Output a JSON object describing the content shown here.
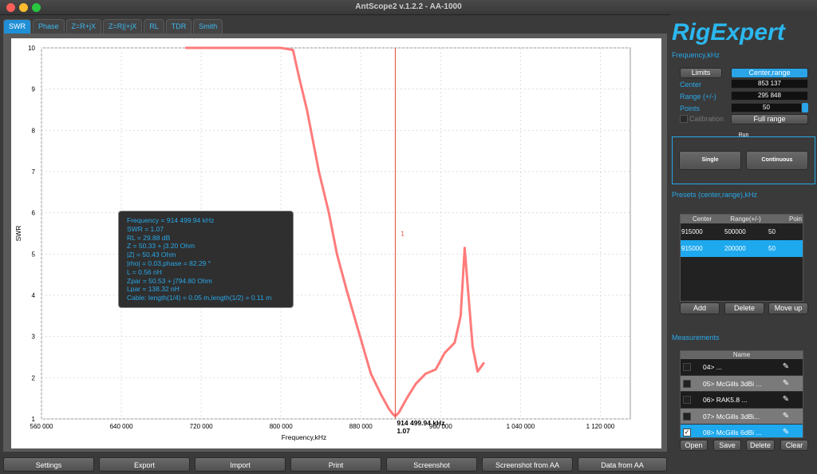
{
  "app": {
    "title": "AntScope2 v.1.2.2 - AA-1000"
  },
  "tabs": [
    "SWR",
    "Phase",
    "Z=R+jX",
    "Z=R||+jX",
    "RL",
    "TDR",
    "Smith"
  ],
  "logo": "RigExpert",
  "frequency_panel": {
    "heading": "Frequency,kHz",
    "limits_label": "Limits",
    "center_range_label": "Center,range",
    "center_label": "Center",
    "center_value": "853 137",
    "range_label": "Range (+/-)",
    "range_value": "295 848",
    "points_label": "Points",
    "points_value": "50",
    "calibration_label": "Calibration",
    "full_range_label": "Full range"
  },
  "run": {
    "heading": "Run",
    "single_label": "Single",
    "continuous_label": "Continuous"
  },
  "presets": {
    "heading": "Presets (center,range),kHz",
    "columns": [
      "Center",
      "Range(+/-)",
      "Poin"
    ],
    "rows": [
      [
        "915000",
        "500000",
        "50"
      ],
      [
        "915000",
        "200000",
        "50"
      ]
    ],
    "add_label": "Add",
    "delete_label": "Delete",
    "move_up_label": "Move up"
  },
  "measurements": {
    "heading": "Measurements",
    "column": "Name",
    "rows": [
      "04> ...",
      "05> McGills 3dBi ...",
      "06> RAK5.8 ...",
      "07> McGills 3dBi...",
      "08> McGills 6dBi ..."
    ],
    "open_label": "Open",
    "save_label": "Save",
    "delete_label": "Delete",
    "clear_label": "Clear"
  },
  "bottom_buttons": [
    "Settings",
    "Export",
    "Import",
    "Print",
    "Screenshot",
    "Screenshot from AA",
    "Data from AA"
  ],
  "tooltip": [
    "Frequency = 914 499.94 kHz",
    "SWR = 1.07",
    "RL = 29.88 dB",
    "Z = 50.33 + j3.20 Ohm",
    "|Z| = 50.43 Ohm",
    "|rho| = 0.03,phase = 82.29 °",
    "L = 0.56 nH",
    "Zpar = 50.53 + j794.80 Ohm",
    "Lpar = 138.32 nH",
    "Cable: length(1/4) = 0.05 m,length(1/2) = 0.11 m"
  ],
  "marker": {
    "label": "1",
    "freq_readout": "914 499.94 kHz",
    "swr_readout": "1.07"
  },
  "colors": {
    "curve": "#ff7b7b",
    "marker": "#e04a3a",
    "accent": "#29a8e8"
  },
  "chart_data": {
    "type": "line",
    "xlabel": "Frequency,kHz",
    "ylabel": "SWR",
    "xlim": [
      560000,
      1150000
    ],
    "ylim": [
      1,
      10
    ],
    "xticks": [
      "560 000",
      "640 000",
      "720 000",
      "800 000",
      "880 000",
      "960 000",
      "1 040 000",
      "1 120 000"
    ],
    "yticks": [
      "1",
      "2",
      "3",
      "4",
      "5",
      "6",
      "7",
      "8",
      "9",
      "10"
    ],
    "grid": true,
    "series": [
      {
        "x": [
          705000,
          720000,
          740000,
          760000,
          780000,
          800000,
          812000,
          818000,
          826000,
          838000,
          848000,
          856000,
          866000,
          878000,
          890000,
          900000,
          908000,
          912000,
          914500,
          918000,
          926000,
          935000,
          945000,
          955000,
          964000,
          974000,
          980000,
          984000,
          987500,
          992000,
          997000,
          1003000
        ],
        "y": [
          10,
          10,
          10,
          10,
          10,
          10,
          9.95,
          9.3,
          8.5,
          7.0,
          6.0,
          5.0,
          4.1,
          3.1,
          2.1,
          1.6,
          1.25,
          1.12,
          1.07,
          1.15,
          1.5,
          1.85,
          2.1,
          2.2,
          2.6,
          2.85,
          3.5,
          5.15,
          4.1,
          2.75,
          2.15,
          2.35
        ]
      }
    ],
    "marker_x": 914500
  }
}
